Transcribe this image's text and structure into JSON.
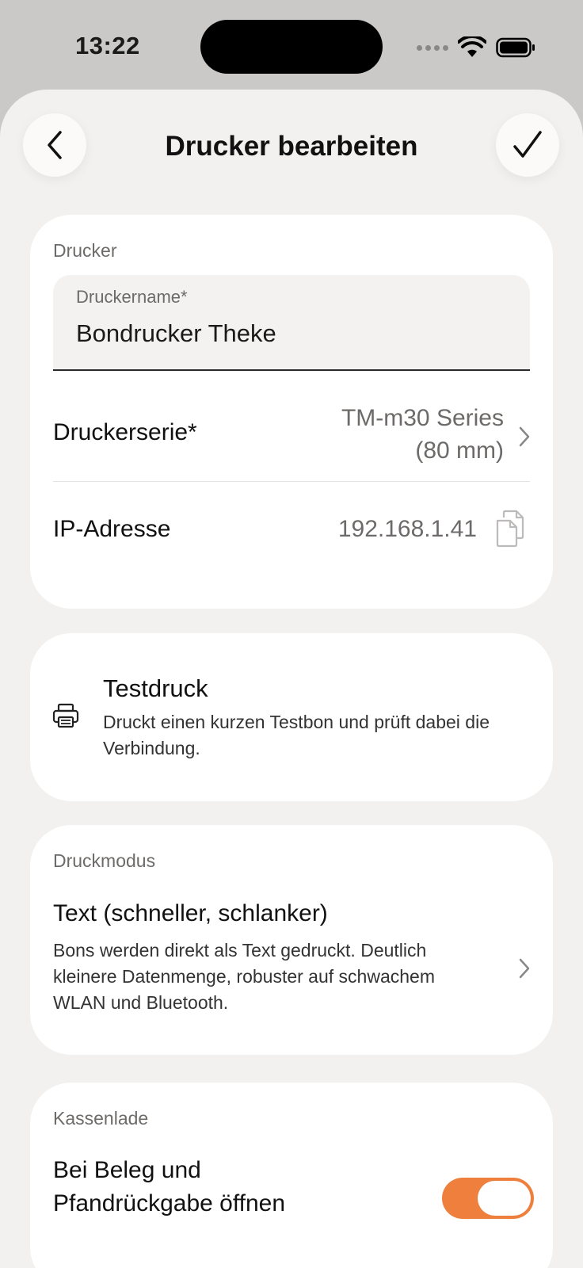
{
  "status_bar": {
    "time": "13:22",
    "icons": [
      "signal-icon",
      "wifi-icon",
      "battery-icon"
    ]
  },
  "header": {
    "title": "Drucker bearbeiten",
    "back_icon": "chevron-left-icon",
    "confirm_icon": "checkmark-icon"
  },
  "printer_section": {
    "label": "Drucker",
    "name_field": {
      "label": "Druckername*",
      "value": "Bondrucker Theke"
    },
    "series": {
      "label": "Druckerserie*",
      "value_line1": "TM-m30 Series",
      "value_line2": "(80 mm)"
    },
    "ip": {
      "label": "IP-Adresse",
      "value": "192.168.1.41",
      "icon": "copy-icon"
    }
  },
  "test_print": {
    "icon": "printer-icon",
    "title": "Testdruck",
    "description": "Druckt einen kurzen Testbon und prüft dabei die Verbindung."
  },
  "print_mode": {
    "label": "Druckmodus",
    "title": "Text (schneller, schlanker)",
    "description": "Bons werden direkt als Text gedruckt. Deutlich kleinere Datenmenge, robuster auf schwachem WLAN und Bluetooth."
  },
  "cash_drawer": {
    "label": "Kassenlade",
    "option_line1": "Bei Beleg und",
    "option_line2": "Pfandrückgabe öffnen",
    "toggle_on": true
  },
  "colors": {
    "accent": "#ee7f3c",
    "background": "#f2f1f0",
    "card": "#ffffff"
  }
}
